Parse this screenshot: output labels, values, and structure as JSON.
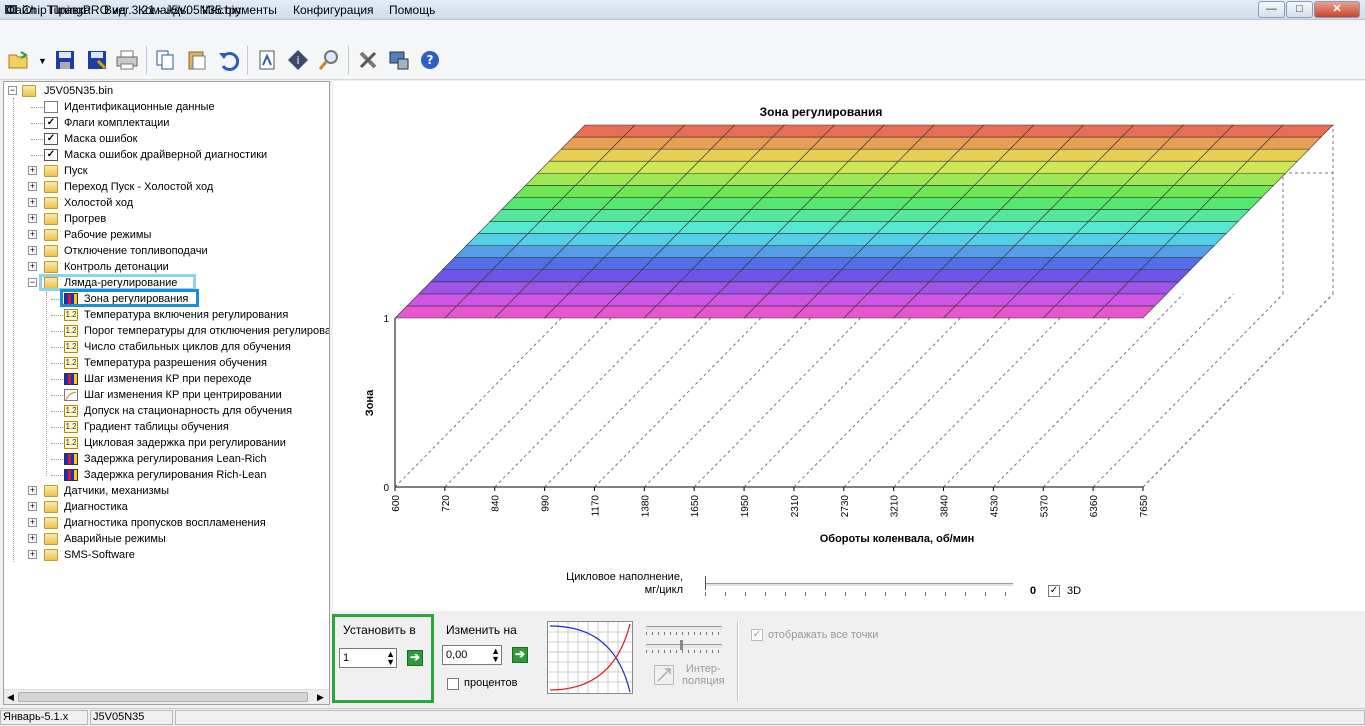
{
  "window": {
    "title": "ChipTuningPRO ver.3.21 - J5V05N35.bin",
    "btn_min": "—",
    "btn_max": "□",
    "btn_close": "✕"
  },
  "menu": [
    "Файл",
    "Правка",
    "Вид",
    "Команды",
    "Инструменты",
    "Конфигурация",
    "Помощь"
  ],
  "toolbar": {
    "icons": [
      "open-icon",
      "save-icon",
      "save-as-icon",
      "print-icon",
      "copy-icon",
      "paste-icon",
      "undo-icon",
      "report-icon",
      "info-icon",
      "search-icon",
      "tools-icon",
      "connect-icon",
      "help-icon"
    ]
  },
  "tree": {
    "root": "J5V05N35.bin",
    "items": [
      {
        "label": "Идентификационные данные",
        "icon": "doc"
      },
      {
        "label": "Флаги комплектации",
        "icon": "check"
      },
      {
        "label": "Маска ошибок",
        "icon": "check"
      },
      {
        "label": "Маска ошибок драйверной диагностики",
        "icon": "check"
      },
      {
        "label": "Пуск",
        "icon": "folder"
      },
      {
        "label": "Переход Пуск - Холостой ход",
        "icon": "folder"
      },
      {
        "label": "Холостой ход",
        "icon": "folder"
      },
      {
        "label": "Прогрев",
        "icon": "folder"
      },
      {
        "label": "Рабочие режимы",
        "icon": "folder"
      },
      {
        "label": "Отключение топливоподачи",
        "icon": "folder"
      },
      {
        "label": "Контроль детонации",
        "icon": "folder"
      },
      {
        "label": "Лямда-регулирование",
        "icon": "folder-open"
      }
    ],
    "children": [
      {
        "label": "Зона регулирования",
        "icon": "bars"
      },
      {
        "label": "Температура включения регулирования",
        "icon": "12"
      },
      {
        "label": "Порог температуры для отключения регулирова",
        "icon": "12"
      },
      {
        "label": "Число стабильных циклов для обучения",
        "icon": "12"
      },
      {
        "label": "Температура разрешения обучения",
        "icon": "12"
      },
      {
        "label": "Шаг изменения КР при переходе",
        "icon": "bars"
      },
      {
        "label": "Шаг изменения КР при центрировании",
        "icon": "curve"
      },
      {
        "label": "Допуск на стационарность для обучения",
        "icon": "12"
      },
      {
        "label": "Градиент таблицы обучения",
        "icon": "12"
      },
      {
        "label": "Цикловая задержка при регулировании",
        "icon": "12"
      },
      {
        "label": "Задержка регулирования Lean-Rich",
        "icon": "bars"
      },
      {
        "label": "Задержка регулирования Rich-Lean",
        "icon": "bars"
      }
    ],
    "tail": [
      "Датчики, механизмы",
      "Диагностика",
      "Диагностика пропусков воспламенения",
      "Аварийные режимы",
      "SMS-Software"
    ]
  },
  "chart_data": {
    "type": "surface",
    "title": "Зона регулирования",
    "xlabel": "Обороты коленвала, об/мин",
    "ylabel": "Зона",
    "x_ticks": [
      "600",
      "720",
      "840",
      "990",
      "1170",
      "1380",
      "1650",
      "1950",
      "2310",
      "2730",
      "3210",
      "3840",
      "4530",
      "5370",
      "6360",
      "7650"
    ],
    "y_ticks": [
      "0",
      "1"
    ],
    "z_rows": 16,
    "value": 1
  },
  "slider": {
    "label_line1": "Цикловое наполнение,",
    "label_line2": "мг/цикл",
    "value": "0",
    "cb3d_label": "3D"
  },
  "bottom": {
    "set_label": "Установить в",
    "set_value": "1",
    "change_label": "Изменить на",
    "change_value": "0,00",
    "percent_label": "процентов",
    "interp_line1": "Интер-",
    "interp_line2": "поляция",
    "show_all_label": "отображать все точки"
  },
  "status": {
    "left": "Январь-5.1.x",
    "file": "J5V05N35"
  },
  "colors": {
    "highlight_blue": "#1a8fd6",
    "highlight_green": "#2aa63a",
    "selection_light": "#8fd3ee"
  }
}
